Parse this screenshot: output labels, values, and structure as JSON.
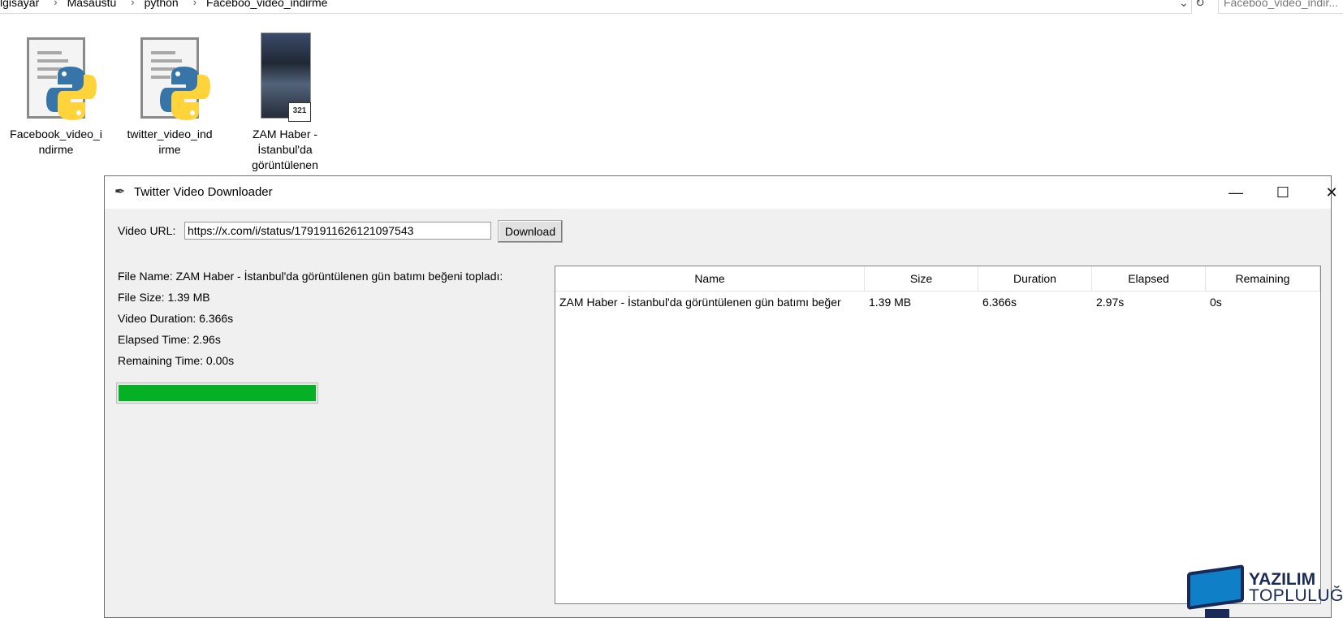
{
  "explorer": {
    "breadcrumbs": [
      "lgisayar",
      "Masaustu",
      "python",
      "Faceboo_video_indirme"
    ],
    "search_value": "Faceboo_video_indir..."
  },
  "files": [
    {
      "label_line1": "Facebook_video_i",
      "label_line2": "ndirme",
      "type": "python-file"
    },
    {
      "label_line1": "twitter_video_ind",
      "label_line2": "irme",
      "type": "python-file"
    },
    {
      "label_line1": "ZAM Haber -",
      "label_line2": "İstanbul'da",
      "label_line3": "görüntülenen",
      "type": "video-file",
      "badge": "321"
    }
  ],
  "window": {
    "title": "Twitter Video Downloader",
    "minimize": "—",
    "maximize": "☐",
    "close": "✕"
  },
  "form": {
    "url_label": "Video URL:",
    "url_value": "https://x.com/i/status/1791911626121097543",
    "download_label": "Download"
  },
  "info": {
    "file_name": "File Name: ZAM Haber - İstanbul'da görüntülenen gün batımı beğeni topladı:",
    "file_size": "File Size: 1.39 MB",
    "video_duration": "Video Duration: 6.366s",
    "elapsed_time": "Elapsed Time: 2.96s",
    "remaining_time": "Remaining Time: 0.00s"
  },
  "progress": {
    "value_percent": 100,
    "color": "#06b025"
  },
  "table": {
    "columns": [
      "Name",
      "Size",
      "Duration",
      "Elapsed",
      "Remaining"
    ],
    "rows": [
      [
        "ZAM Haber - İstanbul'da görüntülenen gün batımı beğer",
        "1.39 MB",
        "6.366s",
        "2.97s",
        "0s"
      ]
    ]
  },
  "watermark": {
    "line1": "YAZILIM",
    "line2": "TOPLULUĞU"
  }
}
